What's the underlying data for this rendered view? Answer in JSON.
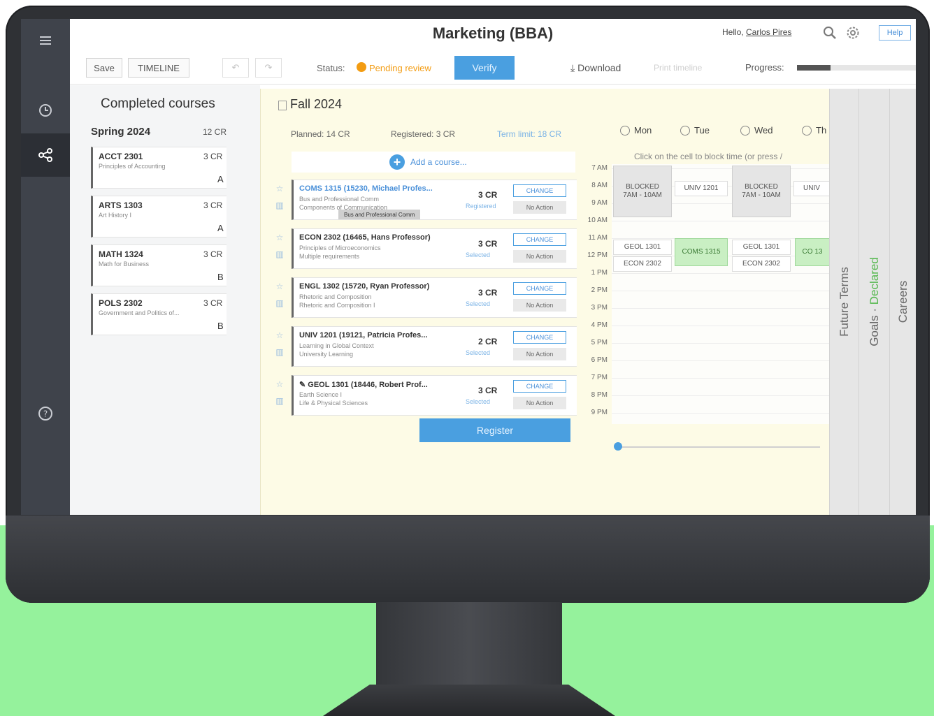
{
  "header": {
    "title": "Marketing (BBA)",
    "greeting": "Hello, ",
    "user_name": "Carlos Pires",
    "help_label": "Help"
  },
  "toolbar": {
    "save_label": "Save",
    "timelines_label": "TIMELINE",
    "undo_label": "↶",
    "redo_label": "↷",
    "status_label": "Status:",
    "status_value": "Pending review",
    "status_color": "#f39c12",
    "verify_label": "Verify",
    "download_label": "Download",
    "faded_action_label": "Print timeline",
    "progress_label": "Progress:",
    "progress_fraction": 0.28
  },
  "rail": {
    "items": [
      {
        "icon": "menu-icon"
      },
      {
        "icon": "history-icon"
      },
      {
        "icon": "share-nodes-icon"
      },
      {
        "icon": "question-icon"
      }
    ]
  },
  "completed": {
    "title": "Completed courses",
    "term": "Spring 2024",
    "term_credits": "12 CR",
    "courses": [
      {
        "code": "ACCT 2301",
        "credits": "3 CR",
        "name": "Principles of Accounting",
        "grade": "A"
      },
      {
        "code": "ARTS 1303",
        "credits": "3 CR",
        "name": "Art History I",
        "grade": "A"
      },
      {
        "code": "MATH 1324",
        "credits": "3 CR",
        "name": "Math for Business",
        "grade": "B"
      },
      {
        "code": "POLS 2302",
        "credits": "3 CR",
        "name": "Government and Politics of...",
        "grade": "B"
      }
    ]
  },
  "fall": {
    "title": "Fall 2024",
    "planned": "Planned: 14 CR",
    "registered": "Registered: 3 CR",
    "term_limit": "Term limit: 18 CR",
    "add_label": "Add a course...",
    "register_label": "Register",
    "tooltip": "Bus and Professional Comm",
    "courses": [
      {
        "title": "COMS 1315 (15230, Michael Profes...",
        "line1": "Bus and Professional Comm",
        "line2": "Components of Communication",
        "credits": "3 CR",
        "status": "Registered",
        "change": "CHANGE",
        "action": "No Action"
      },
      {
        "title": "ECON 2302 (16465, Hans Professor)",
        "line1": "Principles of Microeconomics",
        "line2": "Multiple requirements",
        "credits": "3 CR",
        "status": "Selected",
        "change": "CHANGE",
        "action": "No Action"
      },
      {
        "title": "ENGL 1302 (15720, Ryan Professor)",
        "line1": "Rhetoric and Composition",
        "line2": "Rhetoric and Composition I",
        "credits": "3 CR",
        "status": "Selected",
        "change": "CHANGE",
        "action": "No Action"
      },
      {
        "title": "UNIV 1201 (19121, Patricia Profes...",
        "line1": "Learning in Global Context",
        "line2": "University Learning",
        "credits": "2 CR",
        "status": "Selected",
        "change": "CHANGE",
        "action": "No Action"
      },
      {
        "title": "GEOL 1301 (18446, Robert Prof...",
        "line1": "Earth Science I",
        "line2": "Life & Physical Sciences",
        "credits": "3 CR",
        "status": "Selected",
        "change": "CHANGE",
        "action": "No Action"
      }
    ]
  },
  "schedule": {
    "days": [
      "Mon",
      "Tue",
      "Wed",
      "Th"
    ],
    "hint": "Click on the cell to block time (or press /",
    "times": [
      "7 AM",
      "8 AM",
      "9 AM",
      "10 AM",
      "11 AM",
      "12 PM",
      "1 PM",
      "2 PM",
      "3 PM",
      "4 PM",
      "5 PM",
      "6 PM",
      "7 PM",
      "8 PM",
      "9 PM"
    ],
    "blocked_label": "BLOCKED",
    "blocked_time": "7AM - 10AM",
    "univ_label": "UNIV 1201",
    "univ_short": "UNIV",
    "geol_label": "GEOL 1301",
    "econ_label": "ECON 2302",
    "coms_label": "COMS 1315",
    "cut_label": "CO 13"
  },
  "tabs": {
    "future": "Future Terms",
    "goals": "Goals",
    "goals_sep": " · ",
    "goals_status": "Declared",
    "careers": "Careers"
  }
}
